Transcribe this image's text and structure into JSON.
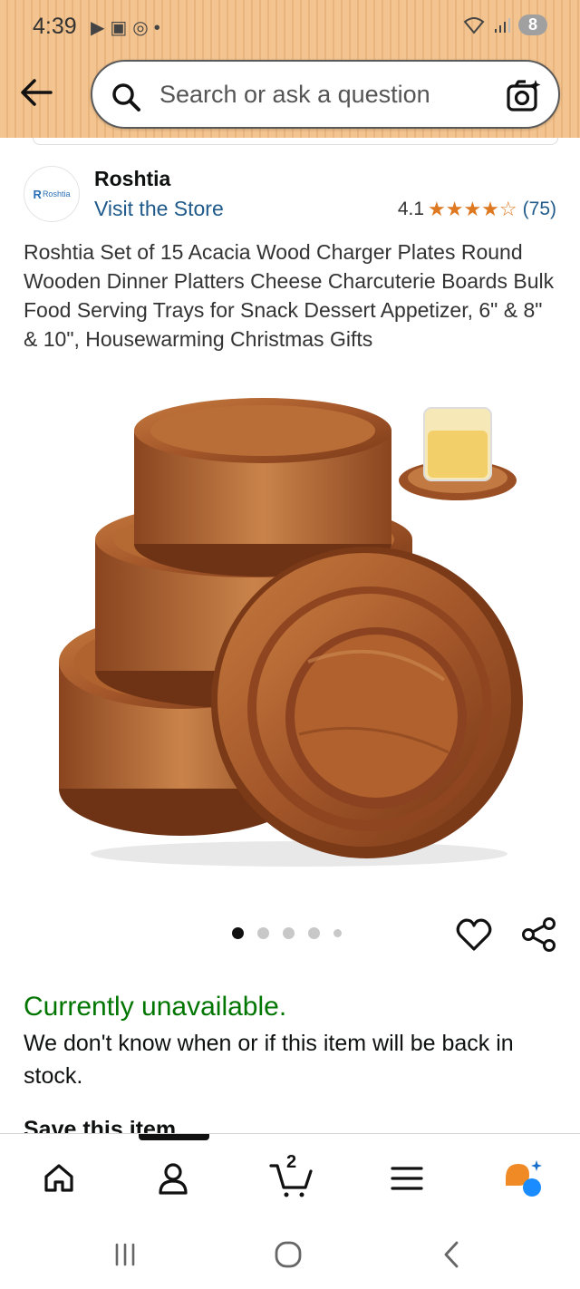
{
  "status_bar": {
    "time": "4:39",
    "battery": "8",
    "icons": [
      "youtube-icon",
      "screenshot-icon",
      "hotspot-icon",
      "dot-icon",
      "wifi-icon",
      "signal-icon"
    ]
  },
  "header": {
    "search_placeholder": "Search or ask a question",
    "icons": [
      "back-arrow-icon",
      "search-icon",
      "camera-search-icon"
    ]
  },
  "brand": {
    "logo_text": "Roshtia",
    "name": "Roshtia",
    "visit_store": "Visit the Store"
  },
  "rating": {
    "value": "4.1",
    "stars": "★★★★☆",
    "count": "(75)"
  },
  "product": {
    "title": "Roshtia Set of 15 Acacia Wood Charger Plates Round Wooden Dinner Platters Cheese Charcuterie Boards Bulk Food Serving Trays for Snack Dessert Appetizer, 6\" & 8\" & 10\", Housewarming Christmas Gifts",
    "image_count": 5,
    "active_image": 1
  },
  "availability": {
    "status": "Currently unavailable.",
    "message": "We don't know when or if this item will be back in stock.",
    "save_item": "Save this item"
  },
  "tabbar": {
    "cart_count": "2",
    "items": [
      "home-tab",
      "account-tab",
      "cart-tab",
      "menu-tab",
      "rufus-tab"
    ]
  },
  "colors": {
    "header_bg": "#f3c48f",
    "link": "#1f5a8a",
    "star": "#de7921",
    "unavailable": "#007600"
  }
}
